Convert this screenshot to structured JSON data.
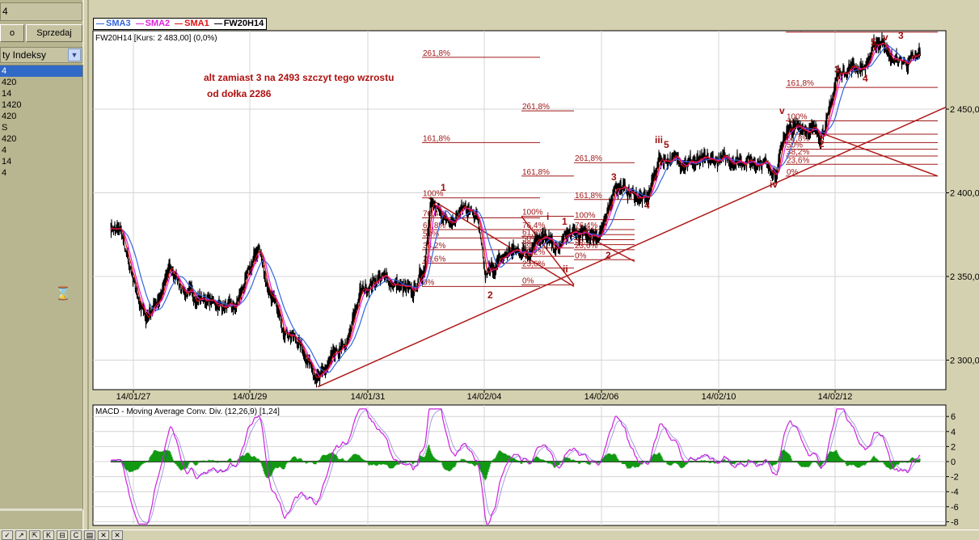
{
  "left_panel": {
    "top_field": "4",
    "buy_button": "o",
    "sell_button": "Sprzedaj",
    "category_dropdown": "ty Indeksy",
    "instruments": [
      "4",
      "420",
      "14",
      "1420",
      "420",
      "S",
      "420",
      "4",
      "14",
      "4"
    ]
  },
  "legend": [
    {
      "label": "SMA3",
      "color": "#3366dd"
    },
    {
      "label": "SMA2",
      "color": "#dd22dd"
    },
    {
      "label": "SMA1",
      "color": "#dd1111"
    },
    {
      "label": "FW20H14",
      "color": "#000000"
    }
  ],
  "main_chart": {
    "info": "FW20H14 [Kurs: 2 483,00] (0,0%)",
    "annotation_line1": "alt zamiast 3 na 2493 szczyt tego wzrostu",
    "annotation_line2": "od dołka 2286"
  },
  "macd_chart": {
    "title": "MACD - Moving Average Conv. Div. (12,26,9) [1,24]"
  },
  "chart_data": [
    {
      "type": "line",
      "title": "FW20H14",
      "ylim": [
        2278,
        2500
      ],
      "yticks": [
        {
          "v": 2450,
          "label": "2 450,00"
        },
        {
          "v": 2400,
          "label": "2 400,00"
        },
        {
          "v": 2350,
          "label": "2 350,00"
        },
        {
          "v": 2300,
          "label": "2 300,00"
        }
      ],
      "xticks": [
        {
          "bar": 28,
          "label": "14/01/27"
        },
        {
          "bar": 172,
          "label": "14/01/29"
        },
        {
          "bar": 318,
          "label": "14/01/31"
        },
        {
          "bar": 462,
          "label": "14/02/04"
        },
        {
          "bar": 607,
          "label": "14/02/06"
        },
        {
          "bar": 752,
          "label": "14/02/10"
        },
        {
          "bar": 896,
          "label": "14/02/12"
        }
      ],
      "price_path": [
        [
          0,
          2380
        ],
        [
          13,
          2376
        ],
        [
          28,
          2345
        ],
        [
          43,
          2325
        ],
        [
          63,
          2340
        ],
        [
          73,
          2355
        ],
        [
          93,
          2340
        ],
        [
          123,
          2335
        ],
        [
          153,
          2330
        ],
        [
          173,
          2355
        ],
        [
          183,
          2368
        ],
        [
          193,
          2345
        ],
        [
          213,
          2320
        ],
        [
          233,
          2310
        ],
        [
          258,
          2288
        ],
        [
          273,
          2300
        ],
        [
          293,
          2310
        ],
        [
          308,
          2340
        ],
        [
          333,
          2350
        ],
        [
          353,
          2345
        ],
        [
          373,
          2340
        ],
        [
          388,
          2355
        ],
        [
          395,
          2395
        ],
        [
          408,
          2385
        ],
        [
          423,
          2385
        ],
        [
          438,
          2392
        ],
        [
          453,
          2385
        ],
        [
          463,
          2350
        ],
        [
          473,
          2355
        ],
        [
          493,
          2365
        ],
        [
          518,
          2365
        ],
        [
          528,
          2375
        ],
        [
          543,
          2370
        ],
        [
          553,
          2365
        ],
        [
          563,
          2375
        ],
        [
          583,
          2375
        ],
        [
          603,
          2375
        ],
        [
          613,
          2383
        ],
        [
          623,
          2405
        ],
        [
          643,
          2400
        ],
        [
          663,
          2395
        ],
        [
          678,
          2420
        ],
        [
          693,
          2420
        ],
        [
          723,
          2418
        ],
        [
          763,
          2420
        ],
        [
          813,
          2418
        ],
        [
          823,
          2410
        ],
        [
          833,
          2435
        ],
        [
          853,
          2440
        ],
        [
          878,
          2435
        ],
        [
          888,
          2445
        ],
        [
          898,
          2470
        ],
        [
          913,
          2475
        ],
        [
          933,
          2475
        ],
        [
          948,
          2490
        ],
        [
          958,
          2490
        ],
        [
          963,
          2480
        ],
        [
          983,
          2478
        ],
        [
          998,
          2480
        ],
        [
          1001,
          2485
        ]
      ],
      "sma_windows": {
        "SMA1": 6,
        "SMA2": 10,
        "SMA3": 22
      },
      "fib_sets": [
        {
          "levels": [
            {
              "label": "100%",
              "v": 2397
            },
            {
              "label": "76,4%",
              "v": 2385
            },
            {
              "label": "61,8%",
              "v": 2378
            },
            {
              "label": "50%",
              "v": 2373
            },
            {
              "label": "38,2%",
              "v": 2366
            },
            {
              "label": "23,6%",
              "v": 2358
            },
            {
              "label": "0%",
              "v": 2344
            },
            {
              "label": "161,8%",
              "v": 2430
            },
            {
              "label": "261,8%",
              "v": 2481
            }
          ]
        },
        {
          "levels": [
            {
              "label": "100%",
              "v": 2386
            },
            {
              "label": "76,4%",
              "v": 2378
            },
            {
              "label": "61,8%",
              "v": 2374
            },
            {
              "label": "50%",
              "v": 2370
            },
            {
              "label": "38,2%",
              "v": 2367
            },
            {
              "label": "28,2%",
              "v": 2362
            },
            {
              "label": "23,6%",
              "v": 2355
            },
            {
              "label": "0%",
              "v": 2345
            },
            {
              "label": "161,8%",
              "v": 2410
            },
            {
              "label": "261,8%",
              "v": 2449
            }
          ]
        },
        {
          "levels": [
            {
              "label": "100%",
              "v": 2384
            },
            {
              "label": "76,4%",
              "v": 2378
            },
            {
              "label": "61,8%",
              "v": 2375
            },
            {
              "label": "50%",
              "v": 2372
            },
            {
              "label": "38,2%",
              "v": 2369
            },
            {
              "label": "23,6%",
              "v": 2366
            },
            {
              "label": "0%",
              "v": 2360
            },
            {
              "label": "161,8%",
              "v": 2396
            },
            {
              "label": "261,8%",
              "v": 2418
            }
          ]
        },
        {
          "levels": [
            {
              "label": "100%",
              "v": 2443
            },
            {
              "label": "76,4%",
              "v": 2435
            },
            {
              "label": "61,8%",
              "v": 2430
            },
            {
              "label": "50%",
              "v": 2426
            },
            {
              "label": "38,2%",
              "v": 2422
            },
            {
              "label": "23,6%",
              "v": 2417
            },
            {
              "label": "0%",
              "v": 2410
            },
            {
              "label": "161,8%",
              "v": 2463
            },
            {
              "label": "261,8%",
              "v": 2496
            }
          ]
        }
      ],
      "trendlines": [
        [
          [
            256,
            2284
          ],
          [
            1074,
            2460
          ]
        ],
        [
          [
            393,
            2397
          ],
          [
            573,
            2344
          ]
        ],
        [
          [
            508,
            2386
          ],
          [
            573,
            2345
          ]
        ],
        [
          [
            573,
            2378
          ],
          [
            648,
            2359
          ]
        ],
        [
          [
            838,
            2443
          ],
          [
            1023,
            2410
          ]
        ]
      ],
      "wave_labels": [
        "1",
        "2",
        "i",
        "1",
        "ii",
        "2",
        "3",
        "4",
        "iii",
        "5",
        "iv",
        "v",
        "2",
        "3",
        "4",
        "5",
        "v",
        "3"
      ]
    },
    {
      "type": "line",
      "title": "MACD (12,26,9)",
      "ylim": [
        -8.5,
        7.5
      ],
      "yticks": [
        6,
        4,
        2,
        0,
        -2,
        -4,
        -6,
        -8
      ],
      "series": [
        {
          "name": "MACD",
          "color": "#cc22dd"
        },
        {
          "name": "Histogram",
          "color": "#119911"
        }
      ]
    }
  ]
}
